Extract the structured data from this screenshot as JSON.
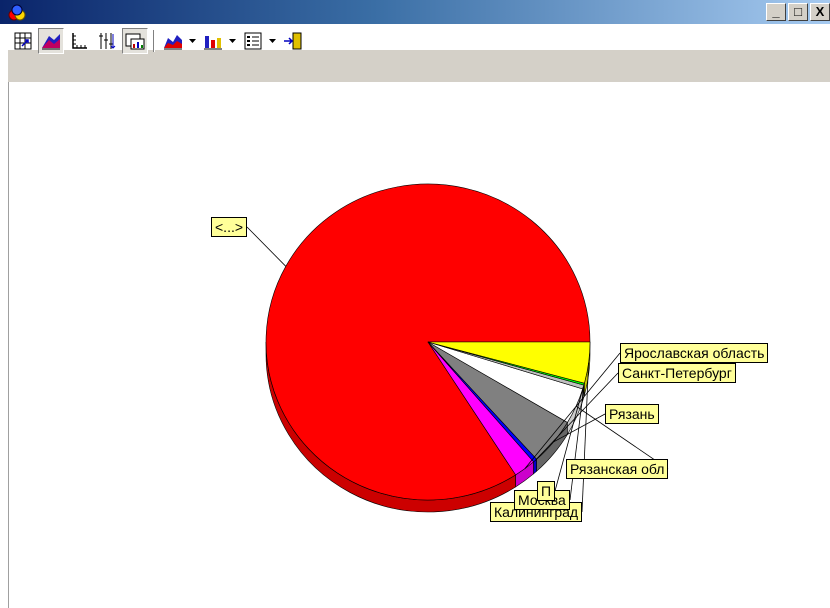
{
  "window": {
    "minimize_label": "_",
    "maximize_label": "□",
    "close_label": "X"
  },
  "toolbar": {
    "buttons": [
      {
        "icon": "crosstab-icon"
      },
      {
        "icon": "chart-3d-icon"
      },
      {
        "icon": "axes-icon"
      },
      {
        "icon": "scale-icon"
      },
      {
        "icon": "chart-window-icon"
      },
      {
        "icon": "area-chart-icon",
        "dropdown": true
      },
      {
        "icon": "bar-chart-icon",
        "dropdown": true
      },
      {
        "icon": "legend-icon",
        "dropdown": true
      },
      {
        "icon": "exit-icon"
      }
    ]
  },
  "chart_data": {
    "type": "pie",
    "three_d": true,
    "categories": [
      "<...>",
      "Ярославская область",
      "Санкт-Петербург",
      "Рязань",
      "Рязанская обл",
      "П",
      "Москва",
      "Калининград"
    ],
    "values": [
      84.1,
      2.2,
      0.4,
      4.8,
      3.7,
      0.4,
      0.2,
      4.2
    ],
    "colors": [
      "#ff0000",
      "#ff00ff",
      "#0000ff",
      "#808080",
      "#ffffff",
      "#c0c0c0",
      "#00ff00",
      "#ffff00"
    ],
    "labels": {
      "other": "<...>",
      "yaroslavl": "Ярославская область",
      "spb": "Санкт-Петербург",
      "ryazan": "Рязань",
      "ryazan_obl": "Рязанская обл",
      "p": "П",
      "moskva": "Москва",
      "kaliningrad": "Калининград"
    }
  }
}
